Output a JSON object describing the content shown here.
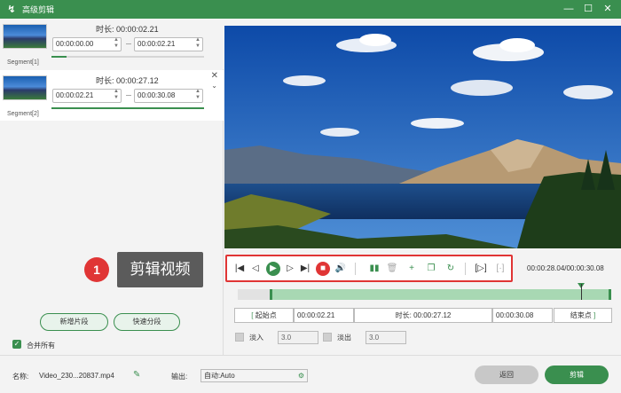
{
  "window": {
    "title": "高级剪辑",
    "controls": {
      "minimize": "—",
      "maximize": "☐",
      "close": "✕"
    }
  },
  "segments": [
    {
      "label": "Segment[1]",
      "duration_label": "时长:",
      "duration": "00:00:02.21",
      "start": "00:00:00.00",
      "end": "00:00:02.21",
      "progress": 0.1
    },
    {
      "label": "Segment[2]",
      "duration_label": "时长:",
      "duration": "00:00:27.12",
      "start": "00:00:02.21",
      "end": "00:00:30.08",
      "progress": 1.0
    }
  ],
  "left_buttons": {
    "new_segment": "新增片段",
    "quick_split": "快速分段"
  },
  "merge_all": {
    "label": "合并所有",
    "checked": true
  },
  "callout": {
    "number": "1",
    "text": "剪辑视频"
  },
  "player": {
    "timecode": "00:00:28.04/00:00:30.08",
    "playhead_fraction": 0.93
  },
  "trim": {
    "start_label": "起始点",
    "start_value": "00:00:02.21",
    "duration_label": "时长:",
    "duration_value": "00:00:27.12",
    "end_value": "00:00:30.08",
    "end_label": "结束点"
  },
  "fade": {
    "fade_in_label": "淡入",
    "fade_in_value": "3.0",
    "fade_out_label": "淡出",
    "fade_out_value": "3.0"
  },
  "output": {
    "name_label": "名称:",
    "name_value": "Video_230...20837.mp4",
    "output_label": "输出:",
    "output_value": "自动:Auto",
    "back_button": "返回",
    "cut_button": "剪辑"
  },
  "colors": {
    "accent": "#3a8f4f",
    "highlight": "#e03535"
  }
}
